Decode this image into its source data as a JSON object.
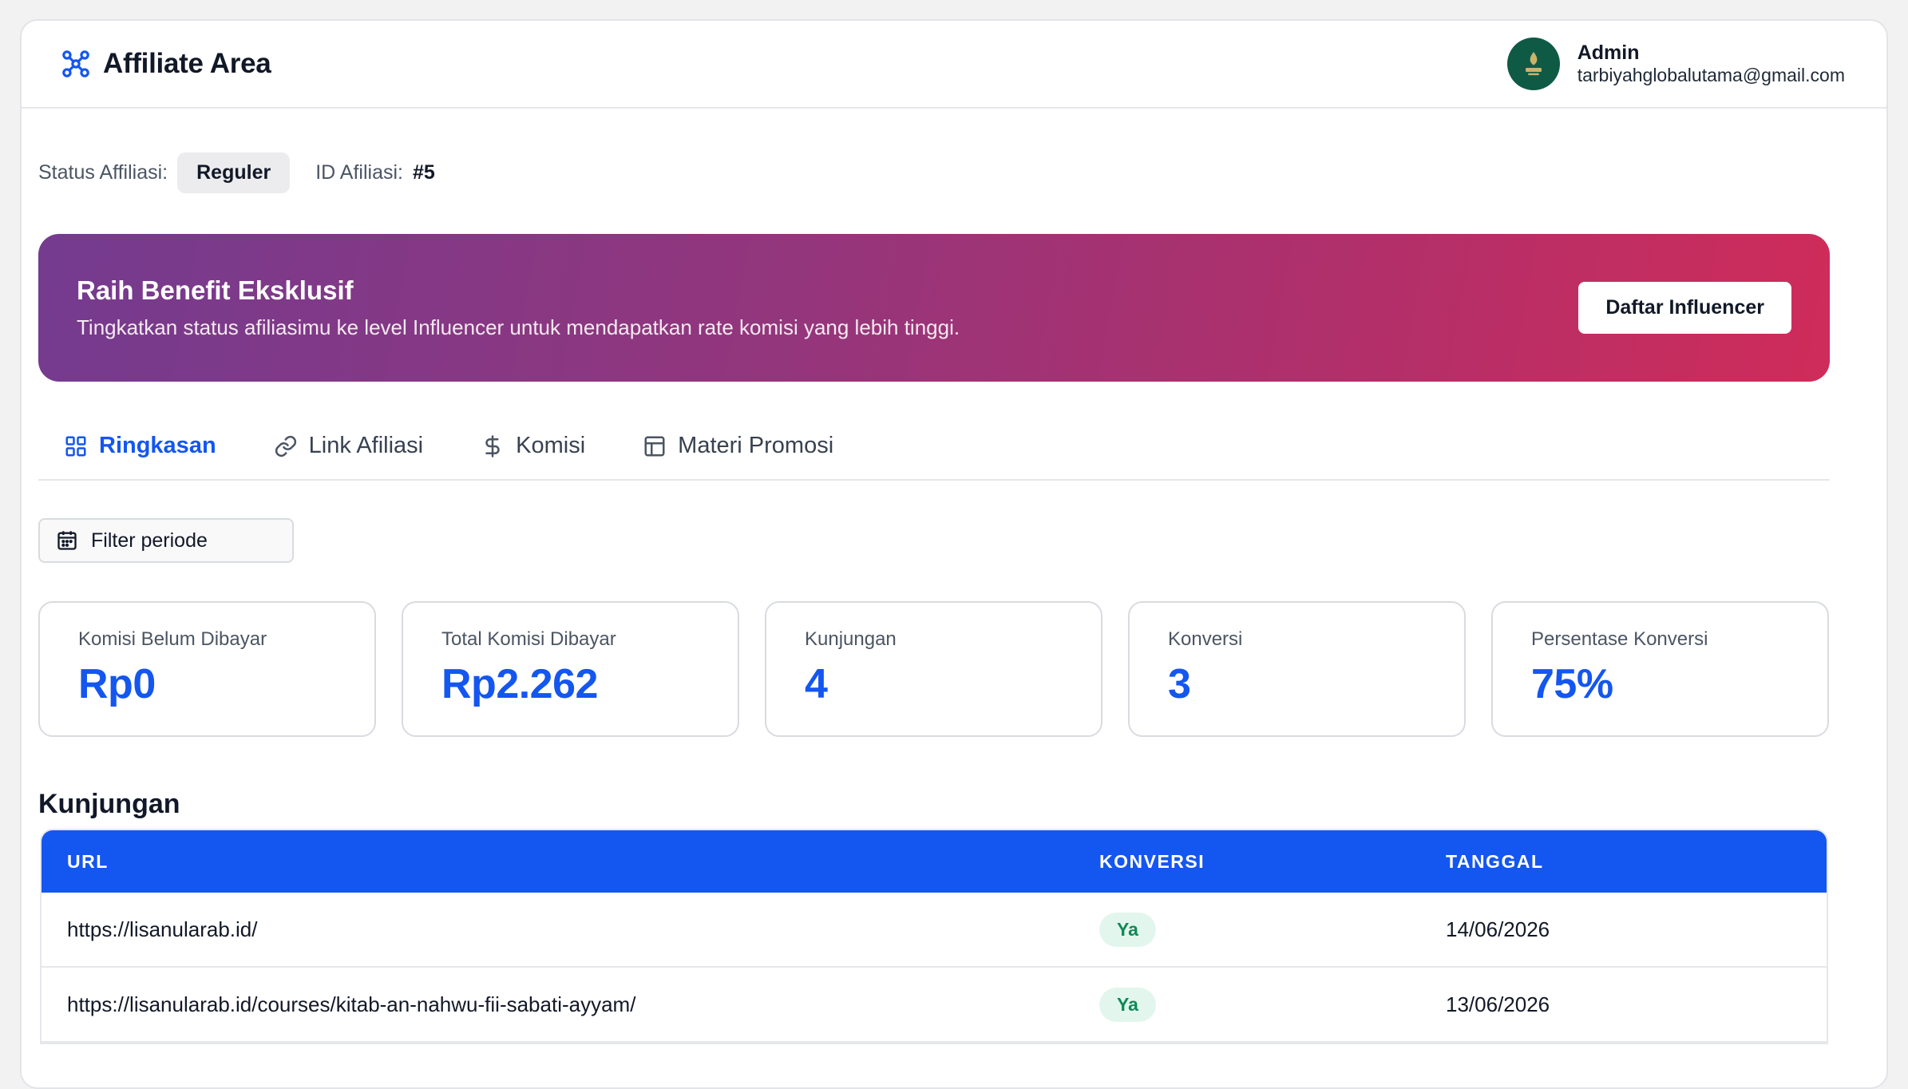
{
  "header": {
    "title": "Affiliate Area",
    "user_name": "Admin",
    "user_email": "tarbiyahglobalutama@gmail.com"
  },
  "status": {
    "label": "Status Affiliasi:",
    "badge": "Reguler",
    "id_label": "ID Afiliasi:",
    "id_value": "#5"
  },
  "banner": {
    "title": "Raih Benefit Eksklusif",
    "text": "Tingkatkan status afiliasimu ke level Influencer untuk mendapatkan rate komisi yang lebih tinggi.",
    "button": "Daftar Influencer"
  },
  "tabs": [
    {
      "label": "Ringkasan",
      "icon": "grid-icon",
      "active": true
    },
    {
      "label": "Link Afiliasi",
      "icon": "link-icon"
    },
    {
      "label": "Komisi",
      "icon": "dollar-icon"
    },
    {
      "label": "Materi Promosi",
      "icon": "layout-icon"
    }
  ],
  "filter": {
    "label": "Filter periode"
  },
  "stats": [
    {
      "label": "Komisi Belum Dibayar",
      "value": "Rp0"
    },
    {
      "label": "Total Komisi Dibayar",
      "value": "Rp2.262"
    },
    {
      "label": "Kunjungan",
      "value": "4"
    },
    {
      "label": "Konversi",
      "value": "3"
    },
    {
      "label": "Persentase Konversi",
      "value": "75%"
    }
  ],
  "visits": {
    "title": "Kunjungan",
    "columns": [
      "URL",
      "KONVERSI",
      "TANGGAL"
    ],
    "rows": [
      {
        "url": "https://lisanularab.id/",
        "konversi": "Ya",
        "tanggal": "14/06/2026"
      },
      {
        "url": "https://lisanularab.id/courses/kitab-an-nahwu-fii-sabati-ayyam/",
        "konversi": "Ya",
        "tanggal": "13/06/2026"
      }
    ]
  },
  "colors": {
    "accent": "#1456f0",
    "banner_start": "#743b8f",
    "banner_end": "#cf2c5a",
    "success_bg": "#e3f6ee",
    "success_text": "#0f8a55"
  }
}
